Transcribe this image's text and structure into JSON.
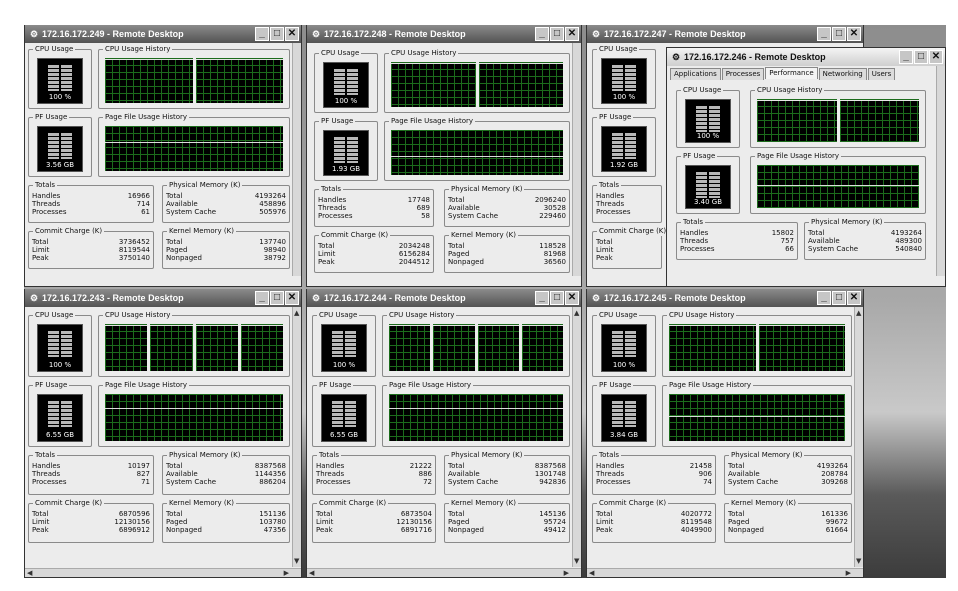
{
  "labels": {
    "cpu_usage": "CPU Usage",
    "cpu_usage_history": "CPU Usage History",
    "pf_usage": "PF Usage",
    "pf_usage_history": "Page File Usage History",
    "totals": "Totals",
    "physical_memory": "Physical Memory (K)",
    "commit_charge": "Commit Charge (K)",
    "kernel_memory": "Kernel Memory (K)",
    "handles": "Handles",
    "threads": "Threads",
    "processes": "Processes",
    "total": "Total",
    "available": "Available",
    "system_cache": "System Cache",
    "limit": "Limit",
    "peak": "Peak",
    "paged": "Paged",
    "nonpaged": "Nonpaged"
  },
  "icons": {
    "app": "remote-desktop-icon",
    "minimize": "minimize-icon",
    "maximize": "maximize-icon",
    "close": "close-icon"
  },
  "windows": {
    "w249": {
      "title": "172.16.172.249 - Remote Desktop",
      "cpu": "100 %",
      "pf": "3.56 GB",
      "totals": {
        "handles": "16966",
        "threads": "714",
        "processes": "61"
      },
      "physical": {
        "total": "4193264",
        "available": "458896",
        "system_cache": "505976"
      },
      "commit": {
        "total": "3736452",
        "limit": "8119544",
        "peak": "3750140"
      },
      "kernel": {
        "total": "137740",
        "paged": "98940",
        "nonpaged": "38792"
      }
    },
    "w248": {
      "title": "172.16.172.248 - Remote Desktop",
      "cpu": "100 %",
      "pf": "1.93 GB",
      "totals": {
        "handles": "17748",
        "threads": "689",
        "processes": "58"
      },
      "physical": {
        "total": "2096240",
        "available": "30528",
        "system_cache": "229460"
      },
      "commit": {
        "total": "2034248",
        "limit": "6156284",
        "peak": "2044512"
      },
      "kernel": {
        "total": "118528",
        "paged": "81968",
        "nonpaged": "36560"
      }
    },
    "w247": {
      "title": "172.16.172.247 - Remote Desktop",
      "cpu": "100 %",
      "pf": "1.92 GB",
      "totals_label": "Totals",
      "handles": "Handles",
      "threads": "Threads",
      "processes": "Processes",
      "commit_label": "Commit Charge (K)",
      "total": "Total",
      "limit": "Limit",
      "peak": "Peak"
    },
    "w246": {
      "title": "172.16.172.246 - Remote Desktop",
      "tabs": [
        "Applications",
        "Processes",
        "Performance",
        "Networking",
        "Users"
      ],
      "cpu": "100 %",
      "pf": "3.40 GB",
      "totals": {
        "handles": "15802",
        "threads": "757",
        "processes": "66"
      },
      "physical": {
        "total": "4193264",
        "available": "489300",
        "system_cache": "540840"
      }
    },
    "w243": {
      "title": "172.16.172.243 - Remote Desktop",
      "cpu": "100 %",
      "pf": "6.55 GB",
      "totals": {
        "handles": "10197",
        "threads": "827",
        "processes": "71"
      },
      "physical": {
        "total": "8387568",
        "available": "1144356",
        "system_cache": "886204"
      },
      "commit": {
        "total": "6870596",
        "limit": "12130156",
        "peak": "6896912"
      },
      "kernel": {
        "total": "151136",
        "paged": "103780",
        "nonpaged": "47356"
      }
    },
    "w244": {
      "title": "172.16.172.244 - Remote Desktop",
      "cpu": "100 %",
      "pf": "6.55 GB",
      "totals": {
        "handles": "21222",
        "threads": "886",
        "processes": "72"
      },
      "physical": {
        "total": "8387568",
        "available": "1301748",
        "system_cache": "942836"
      },
      "commit": {
        "total": "6873504",
        "limit": "12130156",
        "peak": "6891716"
      },
      "kernel": {
        "total": "145136",
        "paged": "95724",
        "nonpaged": "49412"
      }
    },
    "w245": {
      "title": "172.16.172.245 - Remote Desktop",
      "cpu": "100 %",
      "pf": "3.84 GB",
      "totals": {
        "handles": "21458",
        "threads": "906",
        "processes": "74"
      },
      "physical": {
        "total": "4193264",
        "available": "208784",
        "system_cache": "309268"
      },
      "commit": {
        "total": "4020772",
        "limit": "8119548",
        "peak": "4049900"
      },
      "kernel": {
        "total": "161336",
        "paged": "99672",
        "nonpaged": "61664"
      }
    }
  }
}
